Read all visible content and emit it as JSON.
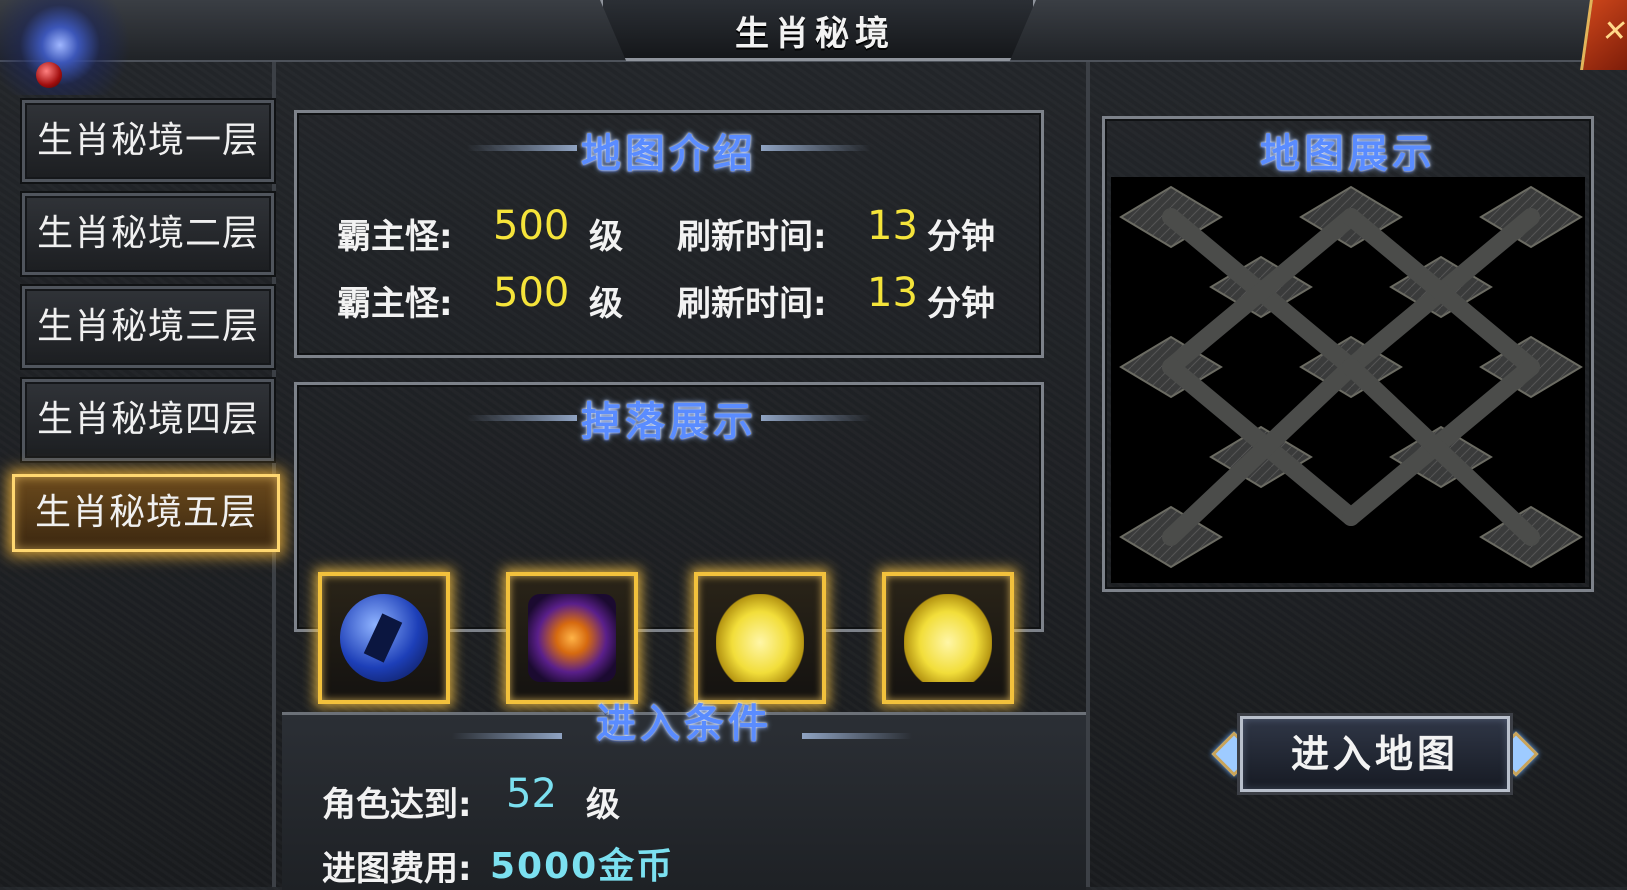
{
  "window": {
    "title": "生肖秘境",
    "close_icon": "close-icon"
  },
  "floors": [
    {
      "label": "生肖秘境一层",
      "selected": false
    },
    {
      "label": "生肖秘境二层",
      "selected": false
    },
    {
      "label": "生肖秘境三层",
      "selected": false
    },
    {
      "label": "生肖秘境四层",
      "selected": false
    },
    {
      "label": "生肖秘境五层",
      "selected": true
    }
  ],
  "intro": {
    "title": "地图介绍",
    "rows": [
      {
        "boss_label": "霸主怪:",
        "boss_level": "500",
        "level_unit": "级",
        "refresh_label": "刷新时间:",
        "refresh_value": "13",
        "refresh_unit": "分钟"
      },
      {
        "boss_label": "霸主怪:",
        "boss_level": "500",
        "level_unit": "级",
        "refresh_label": "刷新时间:",
        "refresh_value": "13",
        "refresh_unit": "分钟"
      }
    ]
  },
  "drops": {
    "title": "掉落展示",
    "items": [
      {
        "icon": "blue-orb-icon"
      },
      {
        "icon": "purple-flame-icon"
      },
      {
        "icon": "golden-dragon-statue-icon"
      },
      {
        "icon": "golden-figure-statue-icon"
      }
    ]
  },
  "conditions": {
    "title": "进入条件",
    "level_label": "角色达到:",
    "level_value": "52",
    "level_unit": "级",
    "cost_label": "进图费用:",
    "cost_value": "5000金币"
  },
  "map": {
    "title": "地图展示"
  },
  "enter_button": {
    "label": "进入地图"
  },
  "colors": {
    "accent_yellow": "#f5e43a",
    "accent_cyan": "#7be0f0",
    "title_blue": "#5a8cff",
    "gold_border": "#f2c13c"
  }
}
